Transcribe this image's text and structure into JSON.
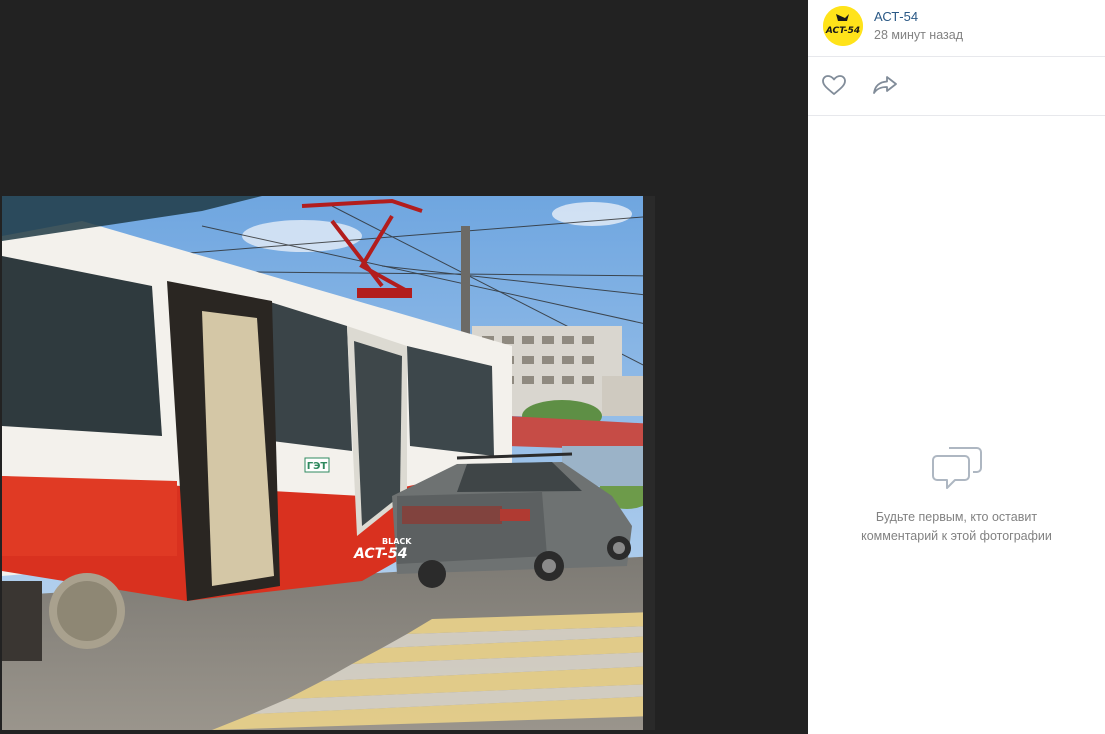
{
  "post": {
    "author_name": "АСТ-54",
    "time": "28 минут назад",
    "avatar_text": "ACT-54"
  },
  "photo": {
    "watermark_small": "BLACK",
    "watermark_main": "ACT-54",
    "tram_logo": "ГЭТ"
  },
  "comments": {
    "empty_text": "Будьте первым, кто оставит комментарий к этой фотографии"
  },
  "icons": {
    "like": "heart-icon",
    "share": "share-arrow-icon",
    "comments": "comment-bubbles-icon"
  },
  "colors": {
    "viewer_bg": "#222222",
    "link": "#2a5885",
    "muted": "#828282",
    "avatar_bg": "#ffe31a"
  }
}
